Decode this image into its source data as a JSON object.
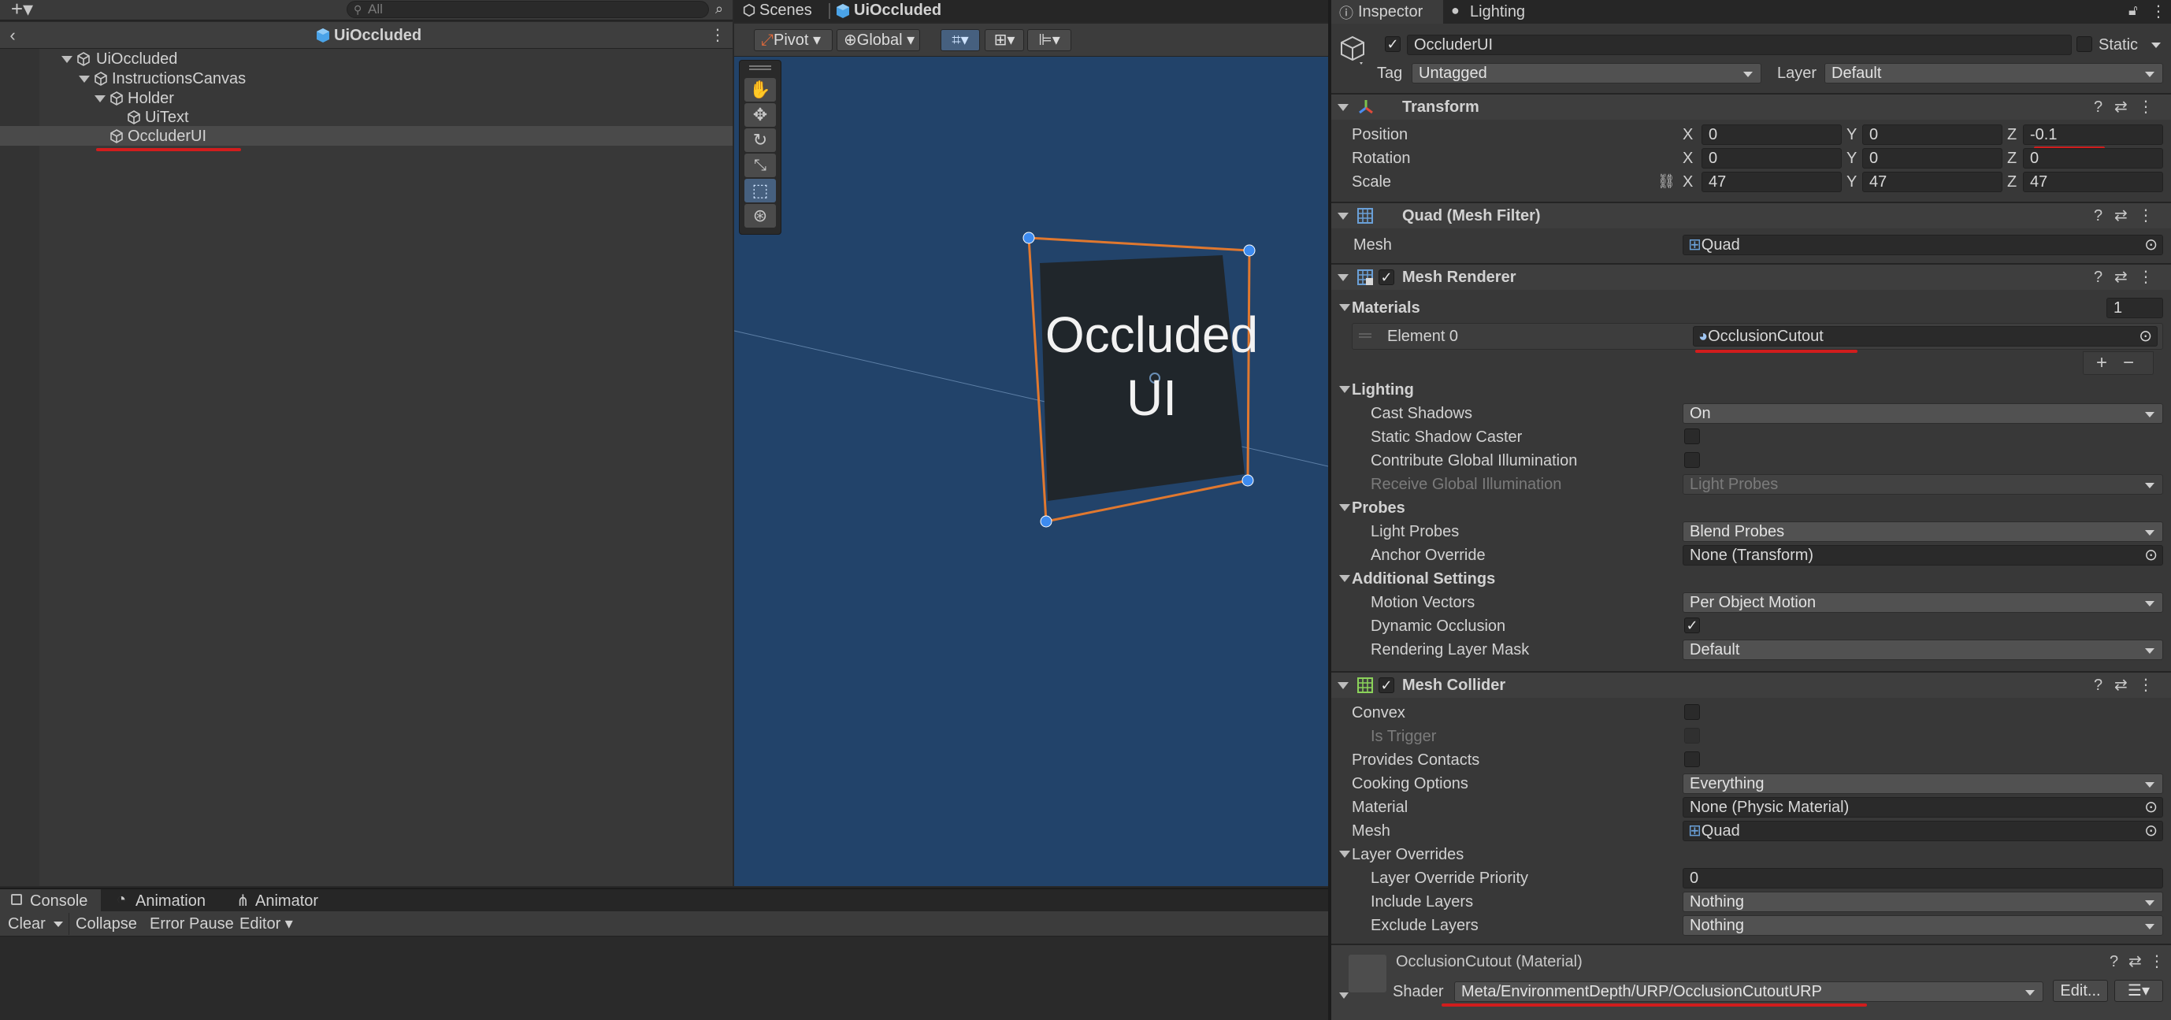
{
  "hierarchy": {
    "search_placeholder": "All",
    "scene_title": "UiOccluded",
    "tree": [
      {
        "label": "UiOccluded"
      },
      {
        "label": "InstructionsCanvas"
      },
      {
        "label": "Holder"
      },
      {
        "label": "UiText"
      },
      {
        "label": "OccluderUI"
      }
    ]
  },
  "scene_view": {
    "tabs": [
      "Scenes",
      "UiOccluded"
    ],
    "pivot_label": "Pivot",
    "global_label": "Global",
    "quad_text": "Occluded\nUI",
    "quad_line1": "Occluded",
    "quad_line2": "UI",
    "accent_color": "#e0782f",
    "bg_color": "#22436a"
  },
  "bottom_panel": {
    "tabs": [
      "Console",
      "Animation",
      "Animator"
    ],
    "toolbar": {
      "clear": "Clear",
      "collapse": "Collapse",
      "error_pause": "Error Pause",
      "editor": "Editor"
    }
  },
  "inspector": {
    "tabs": [
      "Inspector",
      "Lighting"
    ],
    "object_name": "OccluderUI",
    "static_label": "Static",
    "tag_label": "Tag",
    "tag_value": "Untagged",
    "layer_label": "Layer",
    "layer_value": "Default",
    "transform": {
      "title": "Transform",
      "position_label": "Position",
      "rotation_label": "Rotation",
      "scale_label": "Scale",
      "axes": [
        "X",
        "Y",
        "Z"
      ],
      "position": [
        "0",
        "0",
        "-0.1"
      ],
      "rotation": [
        "0",
        "0",
        "0"
      ],
      "scale": [
        "47",
        "47",
        "47"
      ]
    },
    "mesh_filter": {
      "title": "Quad (Mesh Filter)",
      "mesh_label": "Mesh",
      "mesh_value": "Quad"
    },
    "mesh_renderer": {
      "title": "Mesh Renderer",
      "materials_label": "Materials",
      "materials_count": "1",
      "element_label": "Element 0",
      "element_value": "OcclusionCutout",
      "plus": "+",
      "minus": "−",
      "lighting_label": "Lighting",
      "cast_shadows_label": "Cast Shadows",
      "cast_shadows_value": "On",
      "static_shadow_label": "Static Shadow Caster",
      "contribute_gi_label": "Contribute Global Illumination",
      "receive_gi_label": "Receive Global Illumination",
      "receive_gi_value": "Light Probes",
      "probes_label": "Probes",
      "light_probes_label": "Light Probes",
      "light_probes_value": "Blend Probes",
      "anchor_label": "Anchor Override",
      "anchor_value": "None (Transform)",
      "additional_label": "Additional Settings",
      "motion_label": "Motion Vectors",
      "motion_value": "Per Object Motion",
      "dynamic_occ_label": "Dynamic Occlusion",
      "rendering_mask_label": "Rendering Layer Mask",
      "rendering_mask_value": "Default"
    },
    "mesh_collider": {
      "title": "Mesh Collider",
      "convex_label": "Convex",
      "is_trigger_label": "Is Trigger",
      "provides_contacts_label": "Provides Contacts",
      "cooking_label": "Cooking Options",
      "cooking_value": "Everything",
      "material_label": "Material",
      "material_value": "None (Physic Material)",
      "mesh_label": "Mesh",
      "mesh_value": "Quad",
      "layer_overrides_label": "Layer Overrides",
      "priority_label": "Layer Override Priority",
      "priority_value": "0",
      "include_label": "Include Layers",
      "include_value": "Nothing",
      "exclude_label": "Exclude Layers",
      "exclude_value": "Nothing"
    },
    "material": {
      "title": "OcclusionCutout (Material)",
      "shader_label": "Shader",
      "shader_value": "Meta/EnvironmentDepth/URP/OcclusionCutoutURP",
      "edit_label": "Edit..."
    }
  },
  "colors": {
    "highlight_red": "#d11d1d",
    "selection_orange": "#e0782f",
    "handle_blue": "#3d8bf0"
  }
}
